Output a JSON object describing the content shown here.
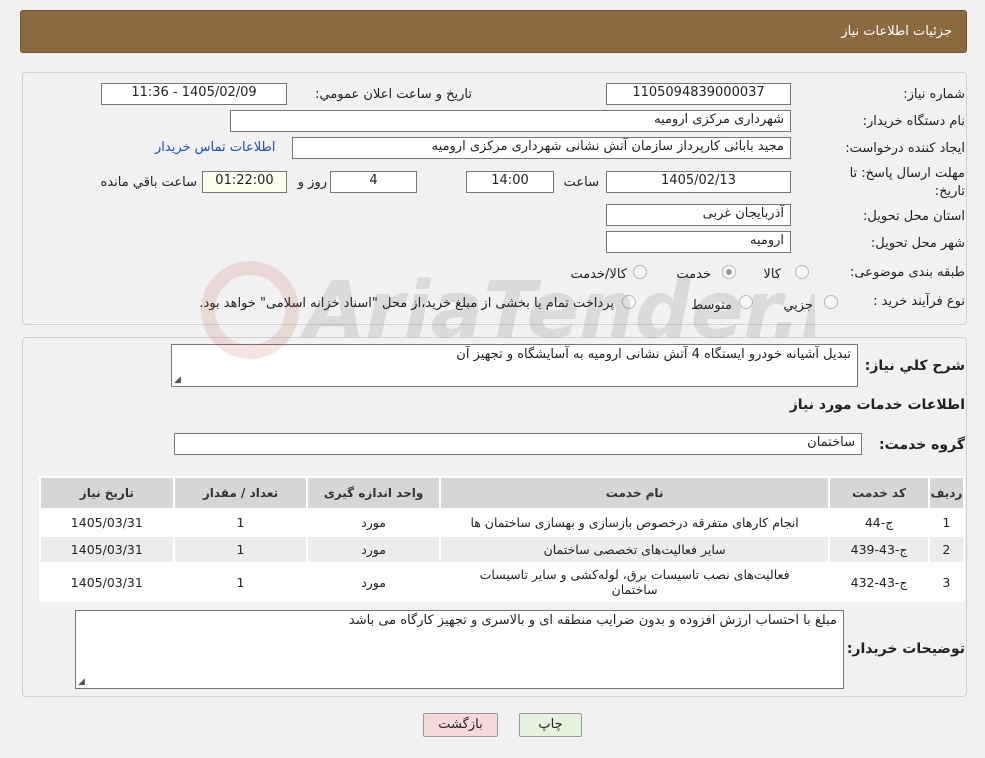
{
  "header": {
    "title": "جزئیات اطلاعات نیاز"
  },
  "form": {
    "need_number": {
      "label": "شماره نیاز:",
      "value": "1105094839000037"
    },
    "announce_datetime": {
      "label": "تاریخ و ساعت اعلان عمومي:",
      "value": "1405/02/09 - 11:36"
    },
    "buyer_org": {
      "label": "نام دستگاه خريدار:",
      "value": "شهرداری مرکزی ارومیه"
    },
    "requester": {
      "label": "ايجاد کننده درخواست:",
      "value": "مجید بابائی کارپرداز سازمان آتش نشانی شهرداری مرکزی ارومیه",
      "contact_link": "اطلاعات تماس خريدار"
    },
    "deadline": {
      "label_line1": "مهلت ارسال پاسخ: تا",
      "label_line2": "تاريخ:",
      "date": "1405/02/13",
      "time_label": "ساعت",
      "time": "14:00",
      "days": "4",
      "days_label": "روز و",
      "remaining": "01:22:00",
      "remaining_label": "ساعت باقي مانده"
    },
    "province": {
      "label": "استان محل تحويل:",
      "value": "آذربایجان غربی"
    },
    "city": {
      "label": "شهر محل تحويل:",
      "value": "ارومیه"
    },
    "category": {
      "label": "طبقه بندی موضوعی:",
      "options": [
        "کالا",
        "خدمت",
        "کالا/خدمت"
      ],
      "selected": "خدمت"
    },
    "purchase_type": {
      "label": "نوع فرآیند خرید :",
      "options": [
        "جزيي",
        "متوسط"
      ],
      "note": "پرداخت تمام يا بخشی از مبلغ خريد،از محل \"اسناد خزانه اسلامی\" خواهد بود."
    }
  },
  "details": {
    "summary_label": "شرح کلي نياز:",
    "summary_value": "تبدیل آشیانه خودرو ایستگاه 4 آتش نشانی ارومیه به آسایشگاه و تجهیز آن",
    "services_title": "اطلاعات خدمات مورد نياز",
    "service_group_label": "گروه خدمت:",
    "service_group_value": "ساختمان",
    "table": {
      "headers": [
        "رديف",
        "کد خدمت",
        "نام خدمت",
        "واحد اندازه گیری",
        "تعداد / مقدار",
        "تاريخ نياز"
      ],
      "rows": [
        [
          "1",
          "ج-44",
          "انجام کارهای متفرقه درخصوص بازسازی و بهسازی ساختمان ها",
          "مورد",
          "1",
          "1405/03/31"
        ],
        [
          "2",
          "ج-43-439",
          "سایر فعالیت‌های تخصصی ساختمان",
          "مورد",
          "1",
          "1405/03/31"
        ],
        [
          "3",
          "ج-43-432",
          "فعالیت‌های نصب تاسیسات برق، لوله‌کشی و سایر تاسیسات ساختمان",
          "مورد",
          "1",
          "1405/03/31"
        ]
      ]
    },
    "buyer_notes_label": "توضيحات خريدار:",
    "buyer_notes_value": "مبلغ با احتساب ارزش افزوده و بدون ضرایب منطقه ای و بالاسری و تجهیز کارگاه می باشد"
  },
  "buttons": {
    "print": "چاپ",
    "back": "بازگشت"
  },
  "watermark": {
    "text": "AriaTender.neT"
  },
  "colors": {
    "header_bg": "#8b6a3f",
    "back_button_bg": "#f6d9d9",
    "print_button_bg": "#e5f3de",
    "link": "#1a4fb5"
  }
}
